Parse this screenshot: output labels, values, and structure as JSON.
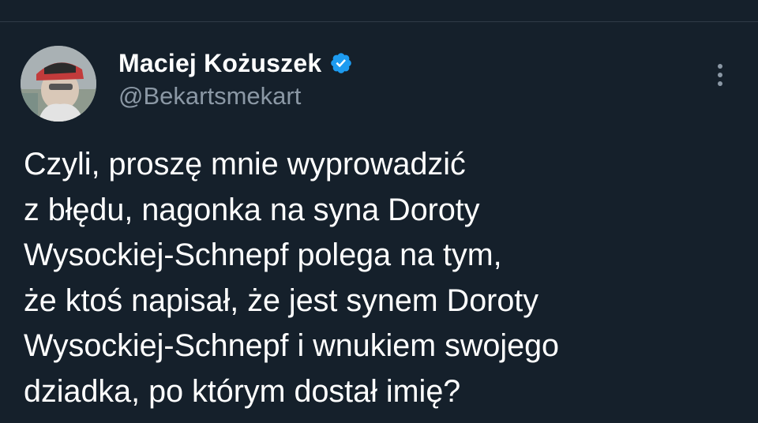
{
  "author": {
    "display_name": "Maciej Kożuszek",
    "handle": "@Bekartsmekart",
    "verified_color": "#1d9bf0"
  },
  "tweet": {
    "text": "Czyli, proszę mnie wyprowadzić\nz błędu, nagonka na syna Doroty\nWysockiej-Schnepf polega na tym,\nże ktoś napisał, że jest synem Doroty\nWysockiej-Schnepf i wnukiem swojego\ndziadka, po którym dostał imię?"
  },
  "icons": {
    "verified": "verified-badge-icon",
    "more": "more-options-icon"
  },
  "colors": {
    "background": "#15202b",
    "text": "#ffffff",
    "secondary_text": "#8b98a5"
  }
}
